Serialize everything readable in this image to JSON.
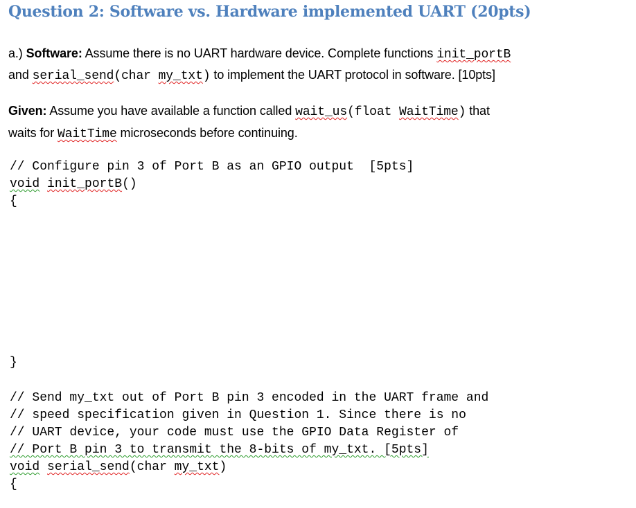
{
  "document": {
    "title": "Question 2: Software vs. Hardware implemented UART (20pts)",
    "part_a": {
      "prefix": "a.) ",
      "label": "Software:",
      "text1": " Assume there is no UART hardware device.  Complete functions ",
      "fn1": "init_portB",
      "line2_start": "and ",
      "fn2_name": "serial_send",
      "fn2_rest": "(char ",
      "fn2_arg": "my_txt",
      "fn2_close": ")",
      "text2": " to implement the UART protocol in software. [10pts]"
    },
    "given": {
      "label": "Given:",
      "text1": "  Assume you have available a function called ",
      "fn_name": "wait_us",
      "fn_paren": "(float ",
      "fn_arg": "WaitTime",
      "fn_close": ")",
      "text2": " that",
      "line2_start": "waits for ",
      "line2_arg": "WaitTime",
      "line2_end": " microseconds before continuing."
    },
    "code_block_1": {
      "comment": "// Configure pin 3 of Port B as an GPIO output  [5pts]",
      "signature_void": "void",
      "signature_name": "init_portB",
      "signature_rest": "()",
      "open_brace": "{",
      "close_brace": "}"
    },
    "code_block_2": {
      "comment_lines": [
        "// Send my_txt out of Port B pin 3 encoded in the UART frame and",
        "// speed specification given in Question 1. Since there is no",
        "// UART device, your code must use the GPIO Data Register of",
        "// Port B pin 3 to transmit the 8-bits of my_txt. [5pts]"
      ],
      "signature_void": "void",
      "signature_name": "serial_send",
      "signature_rest": "(char ",
      "signature_arg": "my_txt",
      "signature_close": ")",
      "open_brace": "{"
    }
  }
}
